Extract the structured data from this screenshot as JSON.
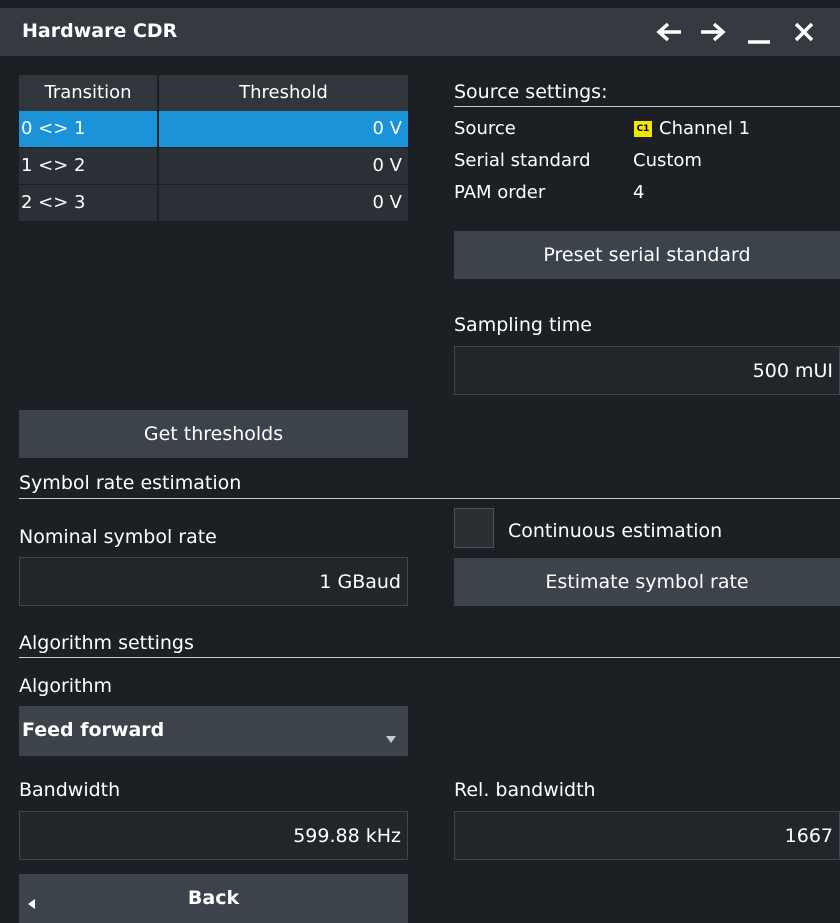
{
  "window": {
    "title": "Hardware CDR",
    "icons": [
      "arrow-left-icon",
      "arrow-right-icon",
      "minimize-icon",
      "close-icon"
    ]
  },
  "thresholds": {
    "headers": [
      "Transition",
      "Threshold"
    ],
    "rows": [
      {
        "transition": "0 <> 1",
        "threshold": "0 V",
        "selected": true
      },
      {
        "transition": "1 <> 2",
        "threshold": "0 V",
        "selected": false
      },
      {
        "transition": "2 <> 3",
        "threshold": "0 V",
        "selected": false
      }
    ],
    "get_button": "Get thresholds"
  },
  "source_settings": {
    "heading": "Source settings:",
    "source_label": "Source",
    "source_badge": "C1",
    "source_value": "Channel 1",
    "standard_label": "Serial standard",
    "standard_value": "Custom",
    "pam_label": "PAM order",
    "pam_value": "4",
    "preset_button": "Preset serial standard",
    "sampling_label": "Sampling time",
    "sampling_value": "500 mUI"
  },
  "symbol_rate": {
    "heading": "Symbol rate estimation",
    "nominal_label": "Nominal symbol rate",
    "nominal_value": "1 GBaud",
    "continuous_label": "Continuous estimation",
    "continuous_checked": false,
    "estimate_button": "Estimate symbol rate"
  },
  "algorithm": {
    "heading": "Algorithm settings",
    "algorithm_label": "Algorithm",
    "algorithm_value": "Feed forward",
    "bandwidth_label": "Bandwidth",
    "bandwidth_value": "599.88 kHz",
    "rel_bandwidth_label": "Rel. bandwidth",
    "rel_bandwidth_value": "1667"
  },
  "back_button": "Back",
  "colors": {
    "background": "#1c2024",
    "titlebar": "#343a40",
    "selected_row": "#1a93d8",
    "button": "#3c434a",
    "channel1_badge": "#f2e600"
  }
}
